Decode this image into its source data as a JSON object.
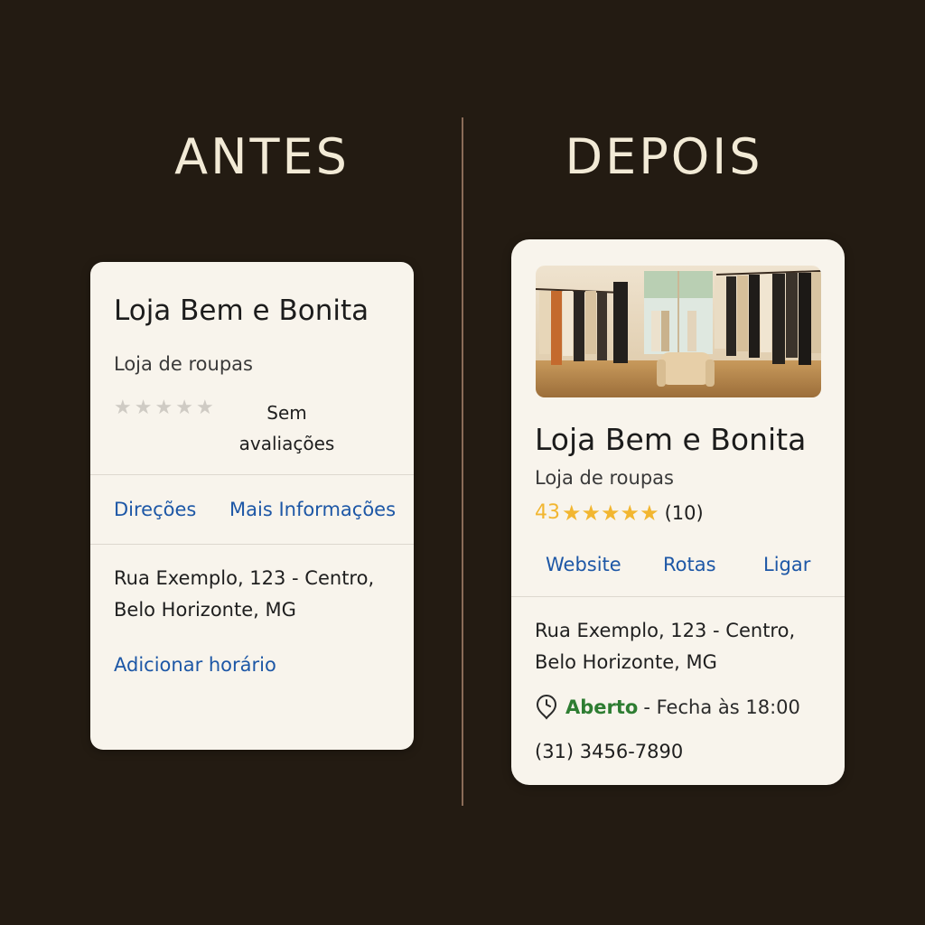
{
  "headings": {
    "before": "ANTES",
    "after": "DEPOIS"
  },
  "before_card": {
    "name": "Loja Bem e Bonita",
    "category": "Loja de roupas",
    "rating_stars": 5,
    "no_reviews": "Sem avaliações",
    "link_directions": "Direções",
    "link_more_info": "Mais Informações",
    "address_line1": "Rua Exemplo, 123 - Centro,",
    "address_line2": "Belo Horizonte, MG",
    "add_hours": "Adicionar horário"
  },
  "after_card": {
    "name": "Loja Bem e Bonita",
    "category": "Loja de roupas",
    "rating": "43",
    "stars": "★★★★★",
    "review_count": "(10)",
    "link_website": "Website",
    "link_routes": "Rotas",
    "link_call": "Ligar",
    "address_line1": "Rua Exemplo, 123 - Centro,",
    "address_line2": "Belo Horizonte, MG",
    "status_open": "Aberto",
    "status_closes": "- Fecha às 18:00",
    "phone": "(31) 3456-7890"
  },
  "colors": {
    "background": "#231b12",
    "card": "#f8f4ec",
    "link": "#1d57a6",
    "star": "#f2b630",
    "open": "#2e7d32"
  }
}
